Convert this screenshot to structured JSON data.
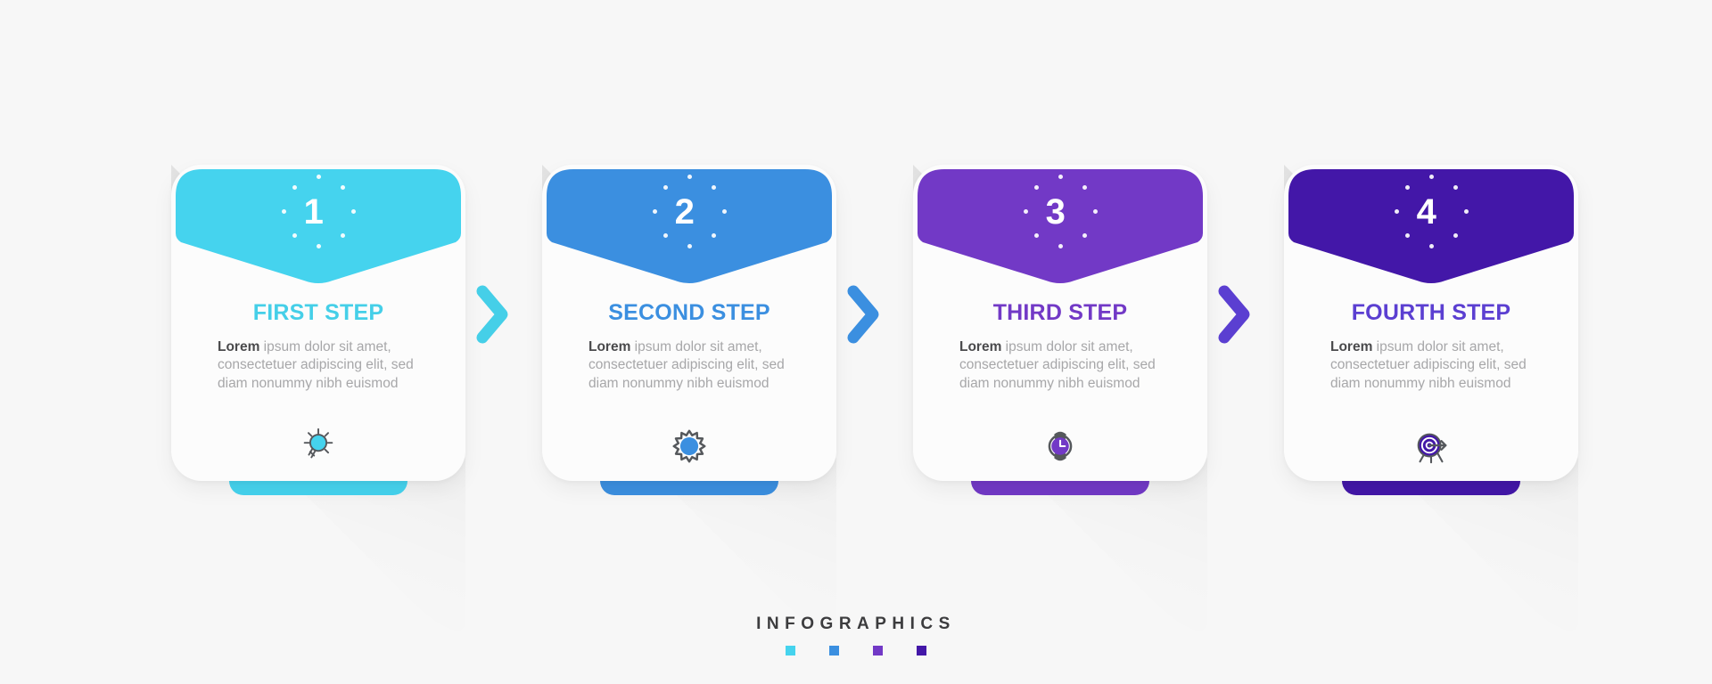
{
  "background_color": "#f7f7f7",
  "footer": {
    "title": "INFOGRAPHICS",
    "swatches": [
      "#45d3ee",
      "#3b8fe0",
      "#7239c6",
      "#4317a8"
    ]
  },
  "chevrons": [
    {
      "name": "chevron-1-2",
      "color": "#45cfe8"
    },
    {
      "name": "chevron-2-3",
      "color": "#3b8fe0"
    },
    {
      "name": "chevron-3-4",
      "color": "#5b3fd1"
    }
  ],
  "body_text": {
    "lead": "Lorem",
    "rest": " ipsum dolor sit amet, consectetuer adipiscing elit, sed diam nonummy nibh euismod"
  },
  "cards": [
    {
      "number": "1",
      "title": "FIRST STEP",
      "color": "#45d3ee",
      "title_color": "#45cfe8",
      "icon": "lightbulb-icon",
      "icon_fill": "#45d3ee",
      "icon_stroke": "#55585c"
    },
    {
      "number": "2",
      "title": "SECOND STEP",
      "color": "#3b8fe0",
      "title_color": "#3b8fe0",
      "icon": "gear-icon",
      "icon_fill": "#3b8fe0",
      "icon_stroke": "#55585c"
    },
    {
      "number": "3",
      "title": "THIRD STEP",
      "color": "#7239c6",
      "title_color": "#7239c6",
      "icon": "wristwatch-icon",
      "icon_fill": "#7239c6",
      "icon_stroke": "#55585c"
    },
    {
      "number": "4",
      "title": "FOURTH STEP",
      "color": "#4317a8",
      "title_color": "#5b3fd1",
      "icon": "target-arrow-icon",
      "icon_fill": "#4317a8",
      "icon_stroke": "#55585c"
    }
  ]
}
